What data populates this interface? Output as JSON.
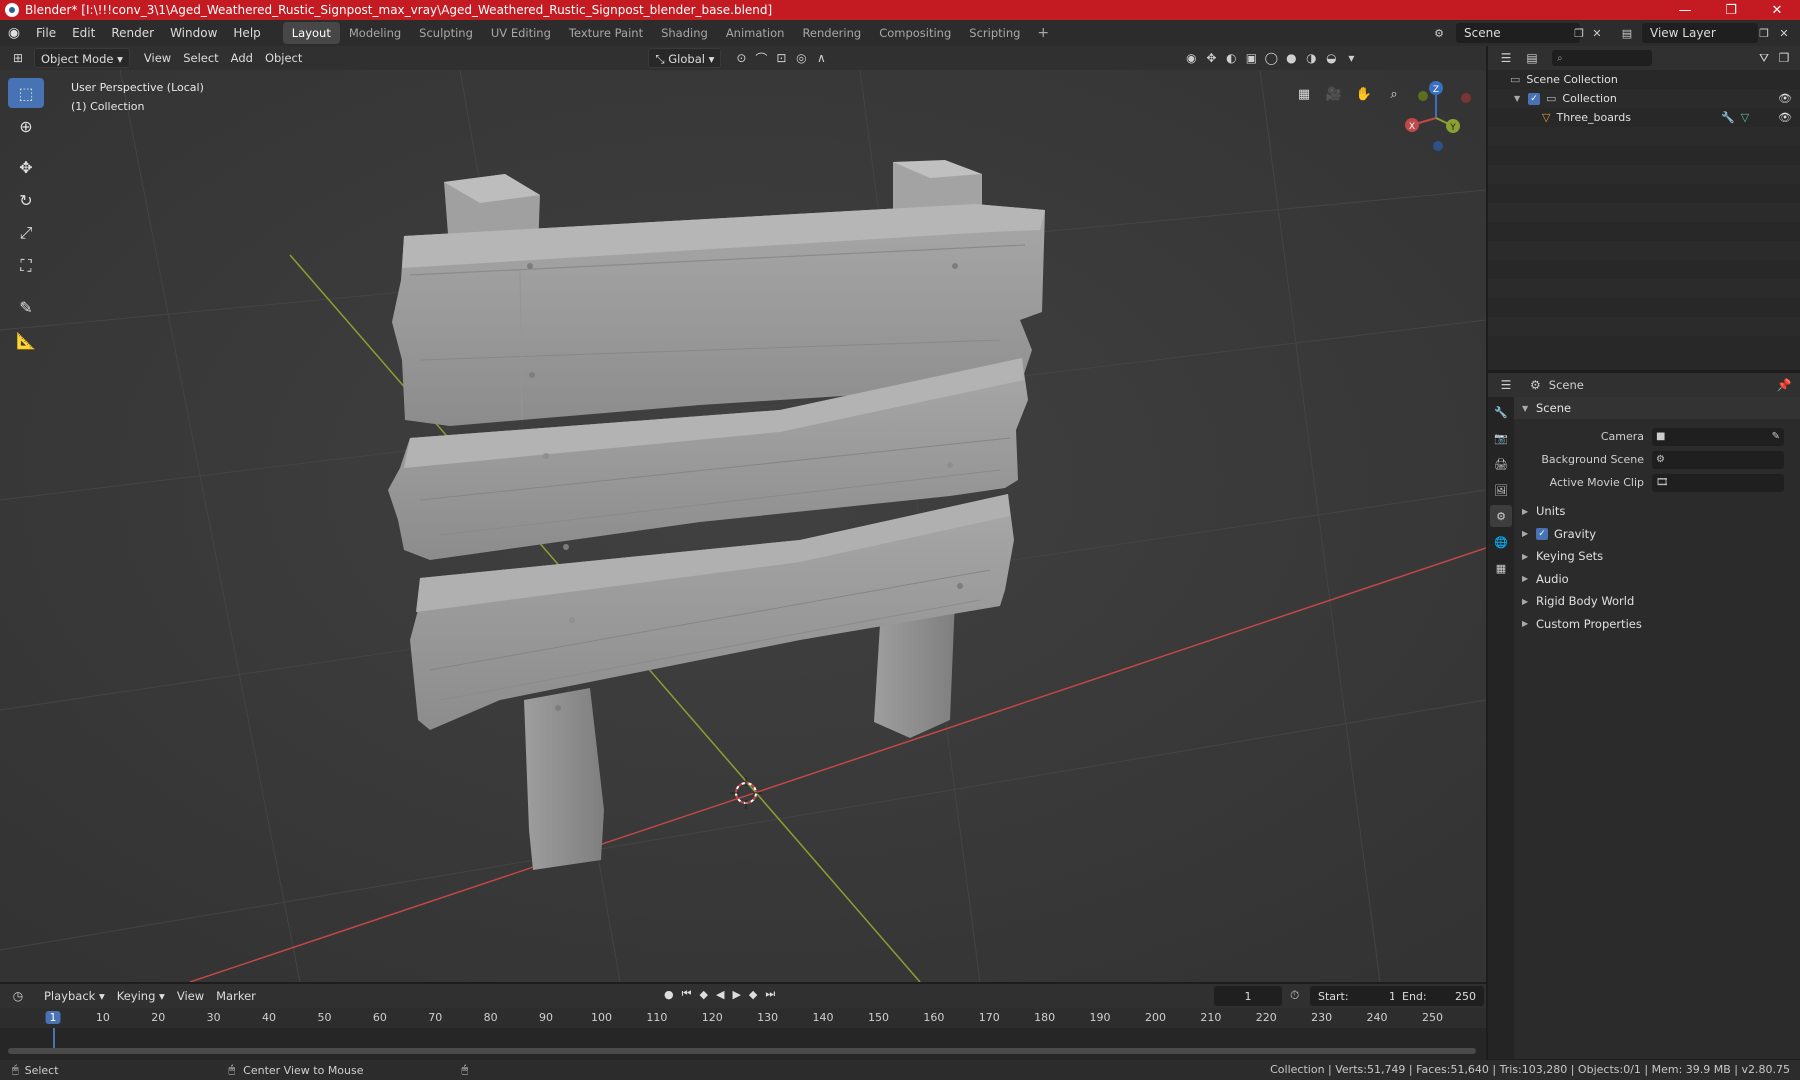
{
  "title_bar": {
    "title": "Blender* [I:\\!!!conv_3\\1\\Aged_Weathered_Rustic_Signpost_max_vray\\Aged_Weathered_Rustic_Signpost_blender_base.blend]",
    "minimize": "—",
    "maximize": "❐",
    "close": "✕"
  },
  "menu": [
    "File",
    "Edit",
    "Render",
    "Window",
    "Help"
  ],
  "workspaces": [
    "Layout",
    "Modeling",
    "Sculpting",
    "UV Editing",
    "Texture Paint",
    "Shading",
    "Animation",
    "Rendering",
    "Compositing",
    "Scripting"
  ],
  "active_workspace": "Layout",
  "add_workspace": "+",
  "scene_selector": "Scene",
  "view_layer_selector": "View Layer",
  "viewport_header": {
    "mode": "Object Mode",
    "menus": [
      "View",
      "Select",
      "Add",
      "Object"
    ],
    "orientation": "Global"
  },
  "viewport": {
    "perspective_label": "User Perspective (Local)",
    "collection_label": "(1) Collection",
    "gizmo": {
      "x": "X",
      "y": "Y",
      "z": "Z"
    }
  },
  "outliner": {
    "root": "Scene Collection",
    "collection": "Collection",
    "object": "Three_boards"
  },
  "properties": {
    "context_label": "Scene",
    "panel_title": "Scene",
    "fields": [
      {
        "label": "Camera",
        "value": ""
      },
      {
        "label": "Background Scene",
        "value": ""
      },
      {
        "label": "Active Movie Clip",
        "value": ""
      }
    ],
    "subpanels": [
      "Units",
      "Gravity",
      "Keying Sets",
      "Audio",
      "Rigid Body World",
      "Custom Properties"
    ]
  },
  "timeline": {
    "menus": [
      "Playback",
      "Keying",
      "View",
      "Marker"
    ],
    "current_frame": "1",
    "start_label": "Start:",
    "start": "1",
    "end_label": "End:",
    "end": "250",
    "ruler": [
      "1",
      "10",
      "20",
      "30",
      "40",
      "50",
      "60",
      "70",
      "80",
      "90",
      "100",
      "110",
      "120",
      "130",
      "140",
      "150",
      "160",
      "170",
      "180",
      "190",
      "200",
      "210",
      "220",
      "230",
      "240",
      "250"
    ]
  },
  "statusbar": {
    "select": "Select",
    "center_view": "Center View to Mouse",
    "stats": "Collection | Verts:51,749 | Faces:51,640 | Tris:103,280 | Objects:0/1 | Mem: 39.9 MB | v2.80.75"
  },
  "colors": {
    "title_red": "#c41a22",
    "accent_blue": "#4772b3",
    "viewport_bg": "#393939",
    "axis_x": "#c04848",
    "axis_y": "#8aa030"
  }
}
